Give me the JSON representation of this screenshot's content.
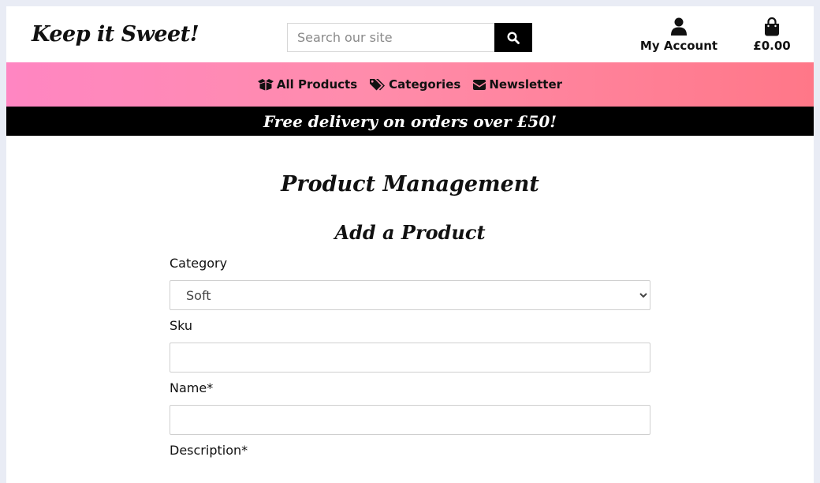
{
  "header": {
    "logo": "Keep it Sweet!",
    "search_placeholder": "Search our site",
    "account_label": "My Account",
    "bag_total": "£0.00"
  },
  "nav": {
    "items": [
      {
        "label": "All Products",
        "icon": "box-open-icon"
      },
      {
        "label": "Categories",
        "icon": "tags-icon"
      },
      {
        "label": "Newsletter",
        "icon": "envelope-icon"
      }
    ]
  },
  "banner": "Free delivery on orders over £50!",
  "main": {
    "title": "Product Management",
    "subtitle": "Add a Product",
    "form": {
      "category_label": "Category",
      "category_value": "Soft",
      "sku_label": "Sku",
      "sku_value": "",
      "name_label": "Name*",
      "name_value": "",
      "description_label": "Description*"
    }
  },
  "colors": {
    "nav_gradient_start": "#ff86c2",
    "nav_gradient_end": "#ff7788",
    "banner_bg": "#000000",
    "page_bg": "#e9ecf5"
  }
}
